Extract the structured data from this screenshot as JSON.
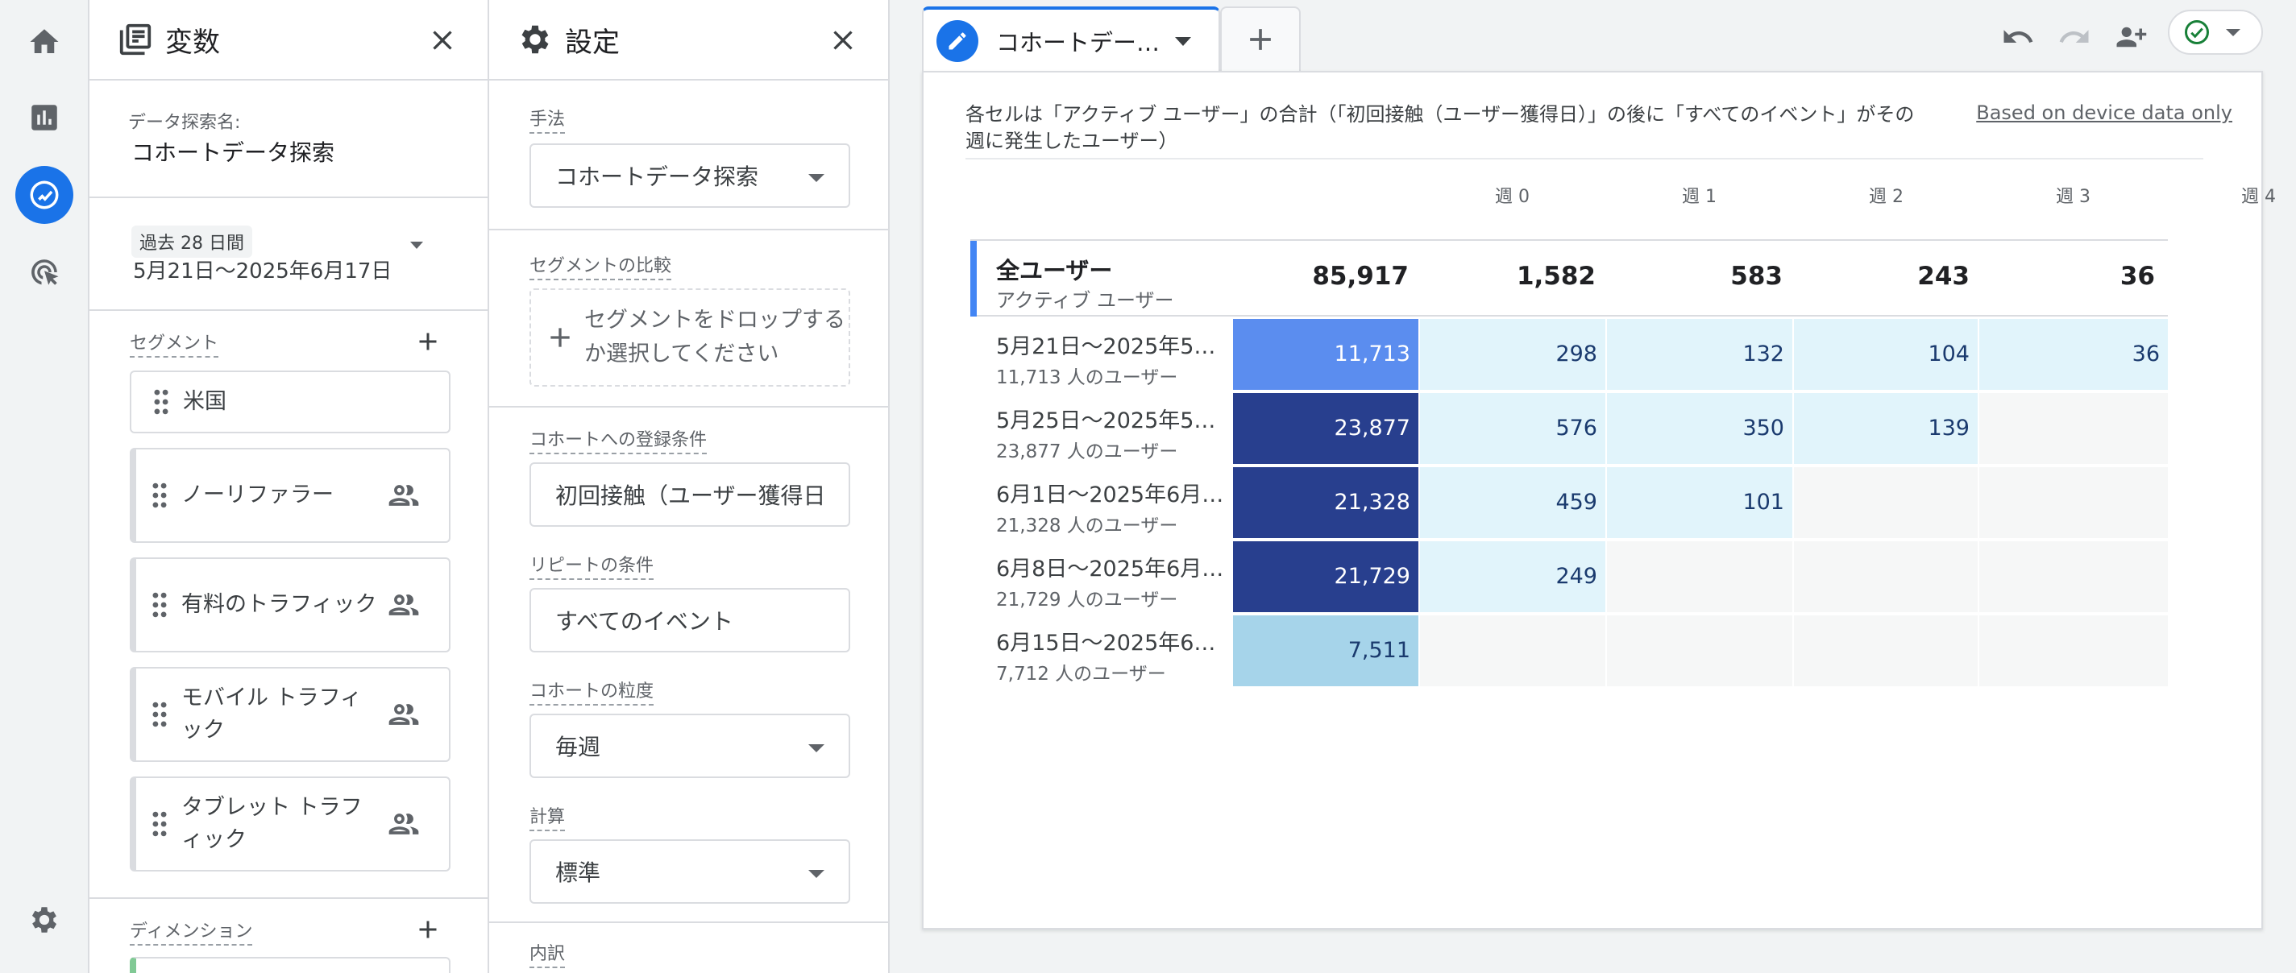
{
  "rail": {
    "icons": [
      "home-icon",
      "reports-icon",
      "explore-icon",
      "advertising-icon",
      "settings-icon"
    ]
  },
  "variables": {
    "title": "変数",
    "exploration_name_label": "データ探索名:",
    "exploration_name": "コホートデータ探索",
    "date_chip": "過去 28 日間",
    "date_range": "5月21日～2025年6月17日",
    "segments_label": "セグメント",
    "segments": [
      "米国",
      "ノーリファラー",
      "有料のトラフィック",
      "モバイル トラフィック",
      "タブレット トラフィック"
    ],
    "dimensions_label": "ディメンション"
  },
  "settings": {
    "title": "設定",
    "technique_label": "手法",
    "technique_value": "コホートデータ探索",
    "segment_compare_label": "セグメントの比較",
    "segment_drop_text": "セグメントをドロップするか選択してください",
    "inclusion_label": "コホートへの登録条件",
    "inclusion_value": "初回接触（ユーザー獲得日",
    "return_label": "リピートの条件",
    "return_value": "すべてのイベント",
    "granularity_label": "コホートの粒度",
    "granularity_value": "毎週",
    "calculation_label": "計算",
    "calculation_value": "標準",
    "breakdown_label": "内訳"
  },
  "tabs": {
    "active": "コホートデー…"
  },
  "report": {
    "description": "各セルは「アクティブ ユーザー」の合計（「初回接触（ユーザー獲得日）」の後に「すべてのイベント」がその週に発生したユーザー）",
    "device_note": "Based on device data only",
    "weeks": [
      "週 0",
      "週 1",
      "週 2",
      "週 3",
      "週 4"
    ],
    "total": {
      "title": "全ユーザー",
      "subtitle": "アクティブ ユーザー",
      "values": [
        "85,917",
        "1,582",
        "583",
        "243",
        "36"
      ]
    },
    "cohorts": [
      {
        "title": "5月21日～2025年5…",
        "subtitle": "11,713 人のユーザー",
        "cells": [
          "11,713",
          "298",
          "132",
          "104",
          "36"
        ]
      },
      {
        "title": "5月25日～2025年5…",
        "subtitle": "23,877 人のユーザー",
        "cells": [
          "23,877",
          "576",
          "350",
          "139",
          ""
        ]
      },
      {
        "title": "6月1日～2025年6月…",
        "subtitle": "21,328 人のユーザー",
        "cells": [
          "21,328",
          "459",
          "101",
          "",
          ""
        ]
      },
      {
        "title": "6月8日～2025年6月…",
        "subtitle": "21,729 人のユーザー",
        "cells": [
          "21,729",
          "249",
          "",
          "",
          ""
        ]
      },
      {
        "title": "6月15日～2025年6…",
        "subtitle": "7,712 人のユーザー",
        "cells": [
          "7,511",
          "",
          "",
          "",
          ""
        ]
      }
    ]
  },
  "colors": {
    "accent": "#1a73e8",
    "cell_dark": "#283f8e",
    "cell_mid": "#5b8def",
    "cell_light": "#a6d4ea",
    "cell_pale": "#e1f4fb",
    "cell_empty": "#f6f7f7"
  }
}
